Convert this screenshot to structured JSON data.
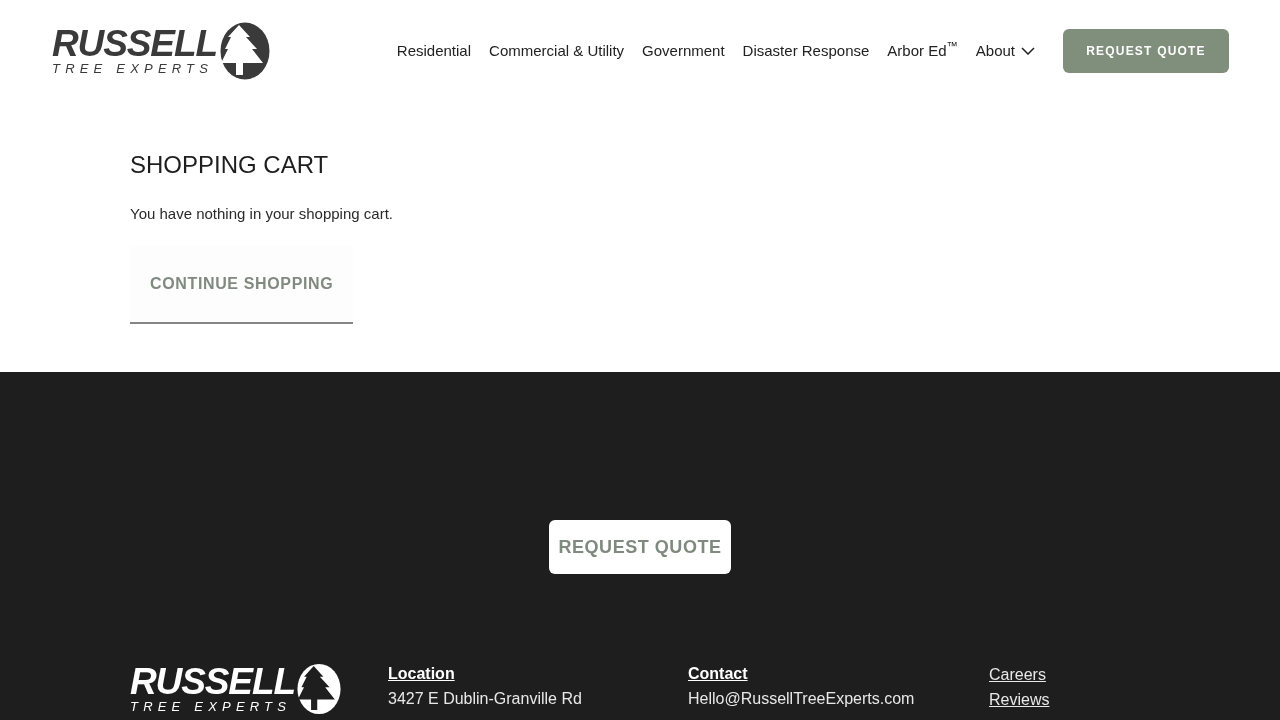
{
  "header": {
    "logo": {
      "name": "RUSSELL",
      "tagline": "TREE EXPERTS"
    },
    "nav": [
      {
        "label": "Residential",
        "kind": "link"
      },
      {
        "label": "Commercial & Utility",
        "kind": "link"
      },
      {
        "label": "Government",
        "kind": "link"
      },
      {
        "label": "Disaster Response",
        "kind": "link"
      },
      {
        "label": "Arbor Ed$^{™}$",
        "kind": "link"
      },
      {
        "label": "About",
        "kind": "dropdown"
      }
    ],
    "cta": "REQUEST QUOTE"
  },
  "cart": {
    "title": "SHOPPING CART",
    "message": "You have nothing in your shopping cart.",
    "button": "CONTINUE SHOPPING"
  },
  "footer": {
    "cta": "REQUEST QUOTE",
    "logo": {
      "name": "RUSSELL",
      "tagline": "TREE EXPERTS"
    },
    "columns": [
      {
        "heading": "Location",
        "lines": [
          "3427 E Dublin-Granville Rd"
        ]
      },
      {
        "heading": "Contact",
        "lines": [
          "Hello@RussellTreeExperts.com"
        ]
      }
    ],
    "links": [
      "Careers",
      "Reviews"
    ]
  }
}
